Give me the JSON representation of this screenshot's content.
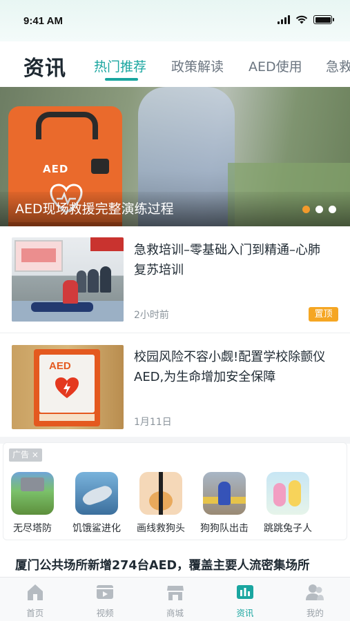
{
  "status_bar": {
    "time": "9:41 AM"
  },
  "header": {
    "title": "资讯",
    "tabs": [
      {
        "label": "热门推荐",
        "active": true
      },
      {
        "label": "政策解读",
        "active": false
      },
      {
        "label": "AED使用",
        "active": false
      },
      {
        "label": "急救",
        "active": false
      }
    ],
    "accent_color": "#1aa6a0"
  },
  "banner": {
    "caption": "AED现场救援完整演练过程",
    "device_label": "AED",
    "dots": 3,
    "active_dot": 0
  },
  "news": [
    {
      "title_line1": "急救培训–零基础入门到精通–心肺",
      "title_line2": "复苏培训",
      "meta": "2小时前",
      "badge": "置顶"
    },
    {
      "title_line1": "校园风险不容小觑!配置学校除颤仪",
      "title_line2": "AED,为生命增加安全保障",
      "meta": "1月11日",
      "thumb_label": "AED"
    }
  ],
  "ad": {
    "tag": "广告 ×",
    "items": [
      {
        "label": "无尽塔防"
      },
      {
        "label": "饥饿鲨进化"
      },
      {
        "label": "画线救狗头"
      },
      {
        "label": "狗狗队出击"
      },
      {
        "label": "跳跳兔子人"
      }
    ]
  },
  "bottom_article": {
    "title": "厦门公共场所新增274台AED，覆盖主要人流密集场所"
  },
  "tabbar": {
    "items": [
      {
        "label": "首页",
        "icon": "home-icon",
        "active": false
      },
      {
        "label": "视频",
        "icon": "video-icon",
        "active": false
      },
      {
        "label": "商城",
        "icon": "store-icon",
        "active": false
      },
      {
        "label": "资讯",
        "icon": "news-icon",
        "active": true
      },
      {
        "label": "我的",
        "icon": "user-icon",
        "active": false
      }
    ]
  }
}
